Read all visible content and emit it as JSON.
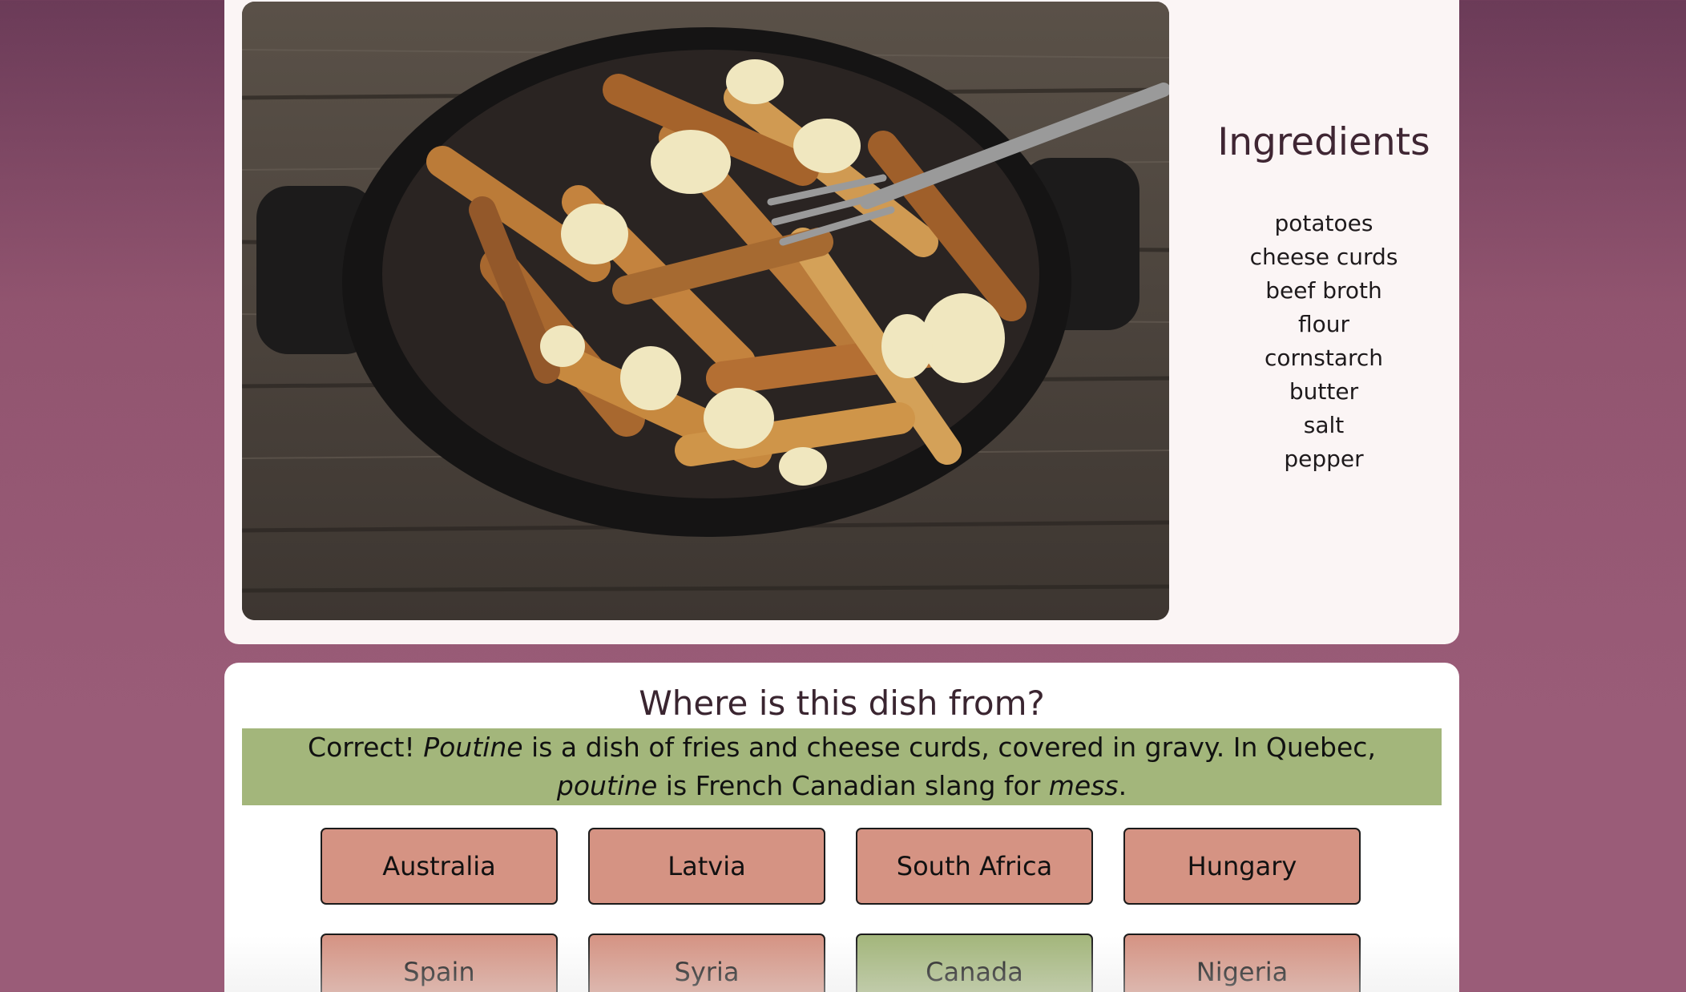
{
  "ingredients": {
    "title": "Ingredients",
    "items": [
      "potatoes",
      "cheese curds",
      "beef broth",
      "flour",
      "cornstarch",
      "butter",
      "salt",
      "pepper"
    ]
  },
  "quiz": {
    "question": "Where is this dish from?",
    "feedback": {
      "prefix": "Correct! ",
      "dish": "Poutine",
      "middle": " is a dish of fries and cheese curds, covered in gravy. In Quebec, ",
      "dish_lower": "poutine",
      "middle2": " is French Canadian slang for ",
      "word": "mess",
      "suffix": "."
    },
    "answers": [
      "Australia",
      "Latvia",
      "South Africa",
      "Hungary",
      "Spain",
      "Syria",
      "Canada",
      "Nigeria"
    ],
    "correct_answer": "Canada"
  },
  "colors": {
    "background": "#91546f",
    "card": "#fbf5f5",
    "answer_default": "#d59383",
    "answer_correct": "#a3b67b",
    "feedback_bg": "#a3b67b"
  }
}
